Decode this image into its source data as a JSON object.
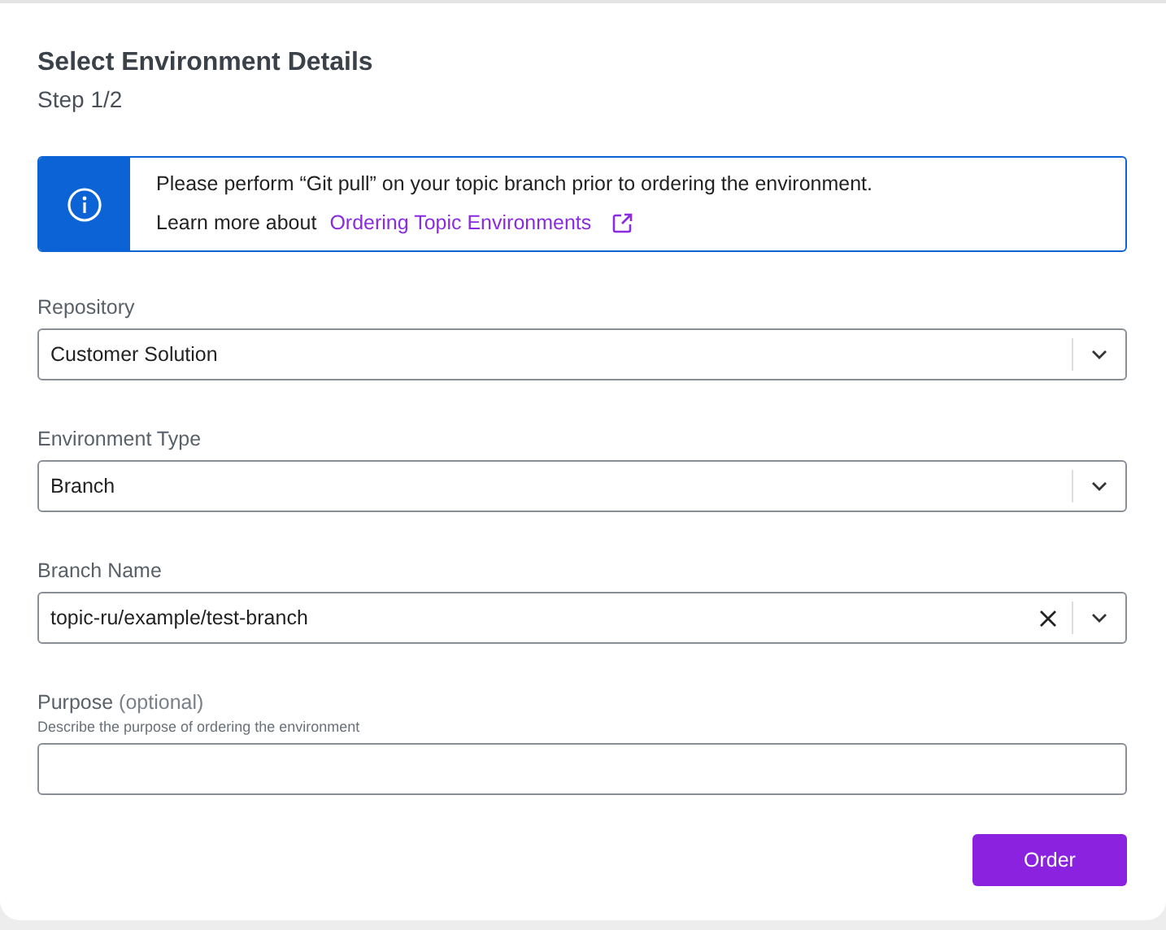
{
  "title": "Select Environment Details",
  "step": "Step 1/2",
  "alert": {
    "message": "Please perform “Git pull” on your topic branch prior to ordering the environment.",
    "learn_prefix": "Learn more about",
    "link": "Ordering Topic Environments"
  },
  "fields": [
    {
      "kind": "select",
      "label": "Repository",
      "value": "Customer Solution",
      "clearable": false
    },
    {
      "kind": "select",
      "label": "Environment Type",
      "value": "Branch",
      "clearable": false
    },
    {
      "kind": "select",
      "label": "Branch Name",
      "value": "topic-ru/example/test-branch",
      "clearable": true
    },
    {
      "kind": "text",
      "label": "Purpose",
      "optional_note": "(optional)",
      "hint": "Describe the purpose of ordering the environment"
    }
  ],
  "buttons": [
    {
      "label": "Order"
    }
  ]
}
